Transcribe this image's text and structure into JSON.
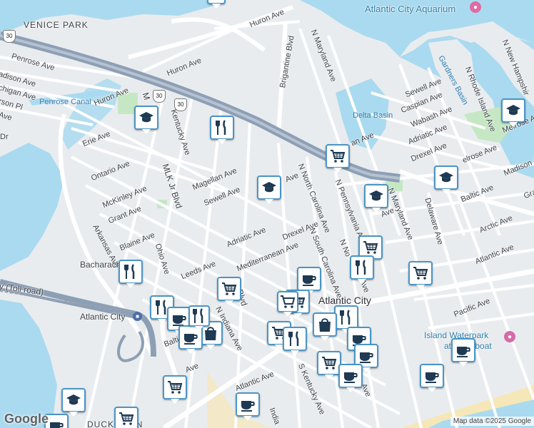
{
  "map": {
    "attribution": "Map data ©2025 Google",
    "logo": "Google",
    "colors": {
      "water": "#aadaef",
      "land": "#e9ecef",
      "road": "#ffffff",
      "highway": "#8d9fb5",
      "park": "#c6e7c3",
      "beach": "#f6e7b8",
      "marker_border": "#4b95c6",
      "marker_icon": "#1f3a52"
    },
    "districts": [
      {
        "id": "venice-park",
        "text": "VENICE PARK"
      },
      {
        "id": "ducktown",
        "text": "DUCKTOWN"
      }
    ],
    "places": [
      {
        "id": "atlantic-city-aquarium",
        "text": "Atlantic City Aquarium",
        "icon": "camera-icon"
      },
      {
        "id": "island-waterpark",
        "text": "Island Waterpark",
        "icon": "water-park-icon"
      },
      {
        "id": "island-waterpark-2",
        "text": "at Showboat"
      },
      {
        "id": "atlantic-city-station",
        "text": "Atlantic City",
        "icon": "train-icon"
      },
      {
        "id": "atlantic-city-label",
        "text": "Atlantic City"
      },
      {
        "id": "penrose-canal",
        "text": "Penrose Canal"
      },
      {
        "id": "delta-basin",
        "text": "Delta Basin"
      },
      {
        "id": "gardners-basin",
        "text": "Gardners Basin"
      },
      {
        "id": "steel-pier",
        "text": "St"
      }
    ],
    "streets": [
      {
        "id": "huron-ave-1",
        "text": "Huron Ave"
      },
      {
        "id": "huron-ave-2",
        "text": "Huron Ave"
      },
      {
        "id": "huron-ave-3",
        "text": "Huron Ave"
      },
      {
        "id": "penrose-ave",
        "text": "Penrose Ave"
      },
      {
        "id": "madison-ave",
        "text": "adison Ave"
      },
      {
        "id": "michigan-ave",
        "text": "chigan Ave"
      },
      {
        "id": "jefferson-pl",
        "text": "rson Pl"
      },
      {
        "id": "ave-left",
        "text": "Ave"
      },
      {
        "id": "dr-left",
        "text": "Dr"
      },
      {
        "id": "erie-ave",
        "text": "Erie Ave"
      },
      {
        "id": "ontario-ave",
        "text": "Ontario Ave"
      },
      {
        "id": "mckinley-ave",
        "text": "McKinley Ave"
      },
      {
        "id": "grant-ave",
        "text": "Grant Ave"
      },
      {
        "id": "arkansas-ave",
        "text": "Arkansas Ave"
      },
      {
        "id": "blaine-ave",
        "text": "Blaine Ave"
      },
      {
        "id": "ohio-ave",
        "text": "Ohio Ave"
      },
      {
        "id": "leeds-ave",
        "text": "Leeds Ave"
      },
      {
        "id": "bacharach",
        "text": "Bacharach"
      },
      {
        "id": "toll-road",
        "text": "y (Toll road)"
      },
      {
        "id": "mlk-blvd-1",
        "text": "MLK Jr Blvd"
      },
      {
        "id": "mlk-blvd-2",
        "text": "M"
      },
      {
        "id": "mlk-blvd-3",
        "text": "Blvd"
      },
      {
        "id": "kentucky-ave",
        "text": "Kentucky Ave"
      },
      {
        "id": "magellan-ave",
        "text": "Magellan Ave"
      },
      {
        "id": "sewell-ave-1",
        "text": "Sewell Ave"
      },
      {
        "id": "adriatic-ave-1",
        "text": "Adriatic Ave"
      },
      {
        "id": "mediterranean-ave",
        "text": "Mediterranean Ave"
      },
      {
        "id": "drexel-ave-1",
        "text": "Drexel Ave"
      },
      {
        "id": "ave-c",
        "text": "Ave"
      },
      {
        "id": "brigantine-blvd",
        "text": "Brigantine Blvd"
      },
      {
        "id": "n-maryland-ave-1",
        "text": "N Maryland Ave"
      },
      {
        "id": "n-north-carolina-ave",
        "text": "N North Carolina Ave"
      },
      {
        "id": "n-south-carolina-ave",
        "text": "N South Carolina Ave"
      },
      {
        "id": "n-pennsylvania-ave",
        "text": "N Pennsylvania Ave"
      },
      {
        "id": "n-no-ave",
        "text": "N No"
      },
      {
        "id": "ina-ave",
        "text": "ina Ave"
      },
      {
        "id": "n-indiana-ave",
        "text": "N Indiana Ave"
      },
      {
        "id": "indiana-ave",
        "text": "India"
      },
      {
        "id": "baltic-ave-1",
        "text": "Balti"
      },
      {
        "id": "ave-d",
        "text": "Ave"
      },
      {
        "id": "atlantic-ave-1",
        "text": "Atlantic Ave"
      },
      {
        "id": "s-kentucky-ave",
        "text": "S Kentucky Ave"
      },
      {
        "id": "ave-e",
        "text": "Ave"
      },
      {
        "id": "sewell-ave-2",
        "text": "Sewell Ave"
      },
      {
        "id": "caspian-ave",
        "text": "Caspian Ave"
      },
      {
        "id": "wabash-ave",
        "text": "Wabash Ave"
      },
      {
        "id": "adriatic-ave-2",
        "text": "Adriatic Ave"
      },
      {
        "id": "drexel-ave-2",
        "text": "Drexel Ave"
      },
      {
        "id": "melrose-ave-1",
        "text": "elrose Ave"
      },
      {
        "id": "melrose-ave-2",
        "text": "Melrose Ave"
      },
      {
        "id": "madison-ave-2",
        "text": "Madison Av"
      },
      {
        "id": "baltic-ave-2",
        "text": "Baltic Ave"
      },
      {
        "id": "arctic-ave",
        "text": "Arctic Ave"
      },
      {
        "id": "atlantic-ave-2",
        "text": "Atlantic Ave"
      },
      {
        "id": "pacific-ave",
        "text": "Pacific Ave"
      },
      {
        "id": "gra-ave",
        "text": "Gra"
      },
      {
        "id": "n-maryland-ave-2",
        "text": "N Maryland Ave"
      },
      {
        "id": "n-rhode-island-ave",
        "text": "N Rhode Island Ave"
      },
      {
        "id": "n-new-hampshire",
        "text": "N New Hampshir"
      },
      {
        "id": "delaware-ave",
        "text": "Delaware Ave"
      },
      {
        "id": "ave-f",
        "text": "an Ave"
      },
      {
        "id": "ave-g",
        "text": "Ave"
      }
    ],
    "shields": [
      {
        "id": "shield-30-a",
        "text": "30"
      },
      {
        "id": "shield-30-b",
        "text": "30"
      },
      {
        "id": "shield-30-c",
        "text": "30"
      }
    ],
    "markers": [
      {
        "id": "school-1",
        "icon": "school-icon"
      },
      {
        "id": "restaurant-1",
        "icon": "restaurant-icon"
      },
      {
        "id": "school-2",
        "icon": "school-icon"
      },
      {
        "id": "grocery-1",
        "icon": "grocery-cart-icon"
      },
      {
        "id": "school-3",
        "icon": "school-icon"
      },
      {
        "id": "school-4",
        "icon": "school-icon"
      },
      {
        "id": "school-5",
        "icon": "school-icon"
      },
      {
        "id": "grocery-2",
        "icon": "grocery-cart-icon"
      },
      {
        "id": "restaurant-2",
        "icon": "restaurant-icon"
      },
      {
        "id": "restaurant-3",
        "icon": "restaurant-icon"
      },
      {
        "id": "grocery-3",
        "icon": "grocery-cart-icon"
      },
      {
        "id": "cafe-1",
        "icon": "coffee-cup-icon"
      },
      {
        "id": "grocery-4",
        "icon": "grocery-cart-icon"
      },
      {
        "id": "grocery-5",
        "icon": "grocery-cart-icon"
      },
      {
        "id": "restaurant-4",
        "icon": "restaurant-icon"
      },
      {
        "id": "cafe-2",
        "icon": "coffee-cup-icon"
      },
      {
        "id": "shopping-1",
        "icon": "shopping-bag-icon"
      },
      {
        "id": "cafe-3",
        "icon": "coffee-cup-icon"
      },
      {
        "id": "restaurant-5",
        "icon": "restaurant-icon"
      },
      {
        "id": "grocery-6",
        "icon": "grocery-cart-icon"
      },
      {
        "id": "shopping-2",
        "icon": "shopping-bag-icon"
      },
      {
        "id": "restaurant-6",
        "icon": "restaurant-icon"
      },
      {
        "id": "cafe-4",
        "icon": "coffee-cup-icon"
      },
      {
        "id": "cafe-5",
        "icon": "coffee-cup-icon"
      },
      {
        "id": "grocery-7",
        "icon": "grocery-cart-icon"
      },
      {
        "id": "cafe-6",
        "icon": "coffee-cup-icon"
      },
      {
        "id": "cafe-7",
        "icon": "coffee-cup-icon"
      },
      {
        "id": "grocery-8",
        "icon": "grocery-cart-icon"
      },
      {
        "id": "cafe-8",
        "icon": "coffee-cup-icon"
      },
      {
        "id": "cafe-9",
        "icon": "coffee-cup-icon"
      },
      {
        "id": "school-6",
        "icon": "school-icon"
      },
      {
        "id": "grocery-9",
        "icon": "grocery-cart-icon"
      },
      {
        "id": "cafe-10",
        "icon": "coffee-cup-icon"
      },
      {
        "id": "grocery-10",
        "icon": "grocery-cart-icon"
      },
      {
        "id": "restaurant-7",
        "icon": "restaurant-icon"
      },
      {
        "id": "cafe-11",
        "icon": "coffee-cup-icon"
      }
    ]
  }
}
